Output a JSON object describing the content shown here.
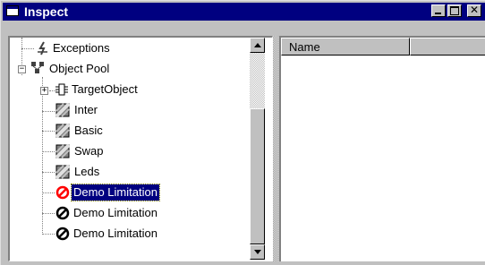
{
  "window": {
    "title": "Inspect"
  },
  "tree": {
    "items": [
      {
        "label": "Exceptions",
        "icon": "exception-icon",
        "selected": false
      },
      {
        "label": "Object Pool",
        "icon": "object-pool-icon",
        "selected": false
      },
      {
        "label": "TargetObject",
        "icon": "target-object-icon",
        "selected": false
      },
      {
        "label": "Inter",
        "icon": "object-icon",
        "selected": false
      },
      {
        "label": "Basic",
        "icon": "object-icon",
        "selected": false
      },
      {
        "label": "Swap",
        "icon": "object-icon",
        "selected": false
      },
      {
        "label": "Leds",
        "icon": "object-icon",
        "selected": false
      },
      {
        "label": "Demo Limitation",
        "icon": "prohibited-icon",
        "selected": true
      },
      {
        "label": "Demo Limitation",
        "icon": "prohibited-icon",
        "selected": false
      },
      {
        "label": "Demo Limitation",
        "icon": "prohibited-icon",
        "selected": false
      }
    ]
  },
  "list": {
    "columns": [
      {
        "label": "Name"
      },
      {
        "label": ""
      }
    ]
  },
  "colors": {
    "titlebar": "#000080",
    "selection": "#000080",
    "face": "#c0c0c0"
  }
}
